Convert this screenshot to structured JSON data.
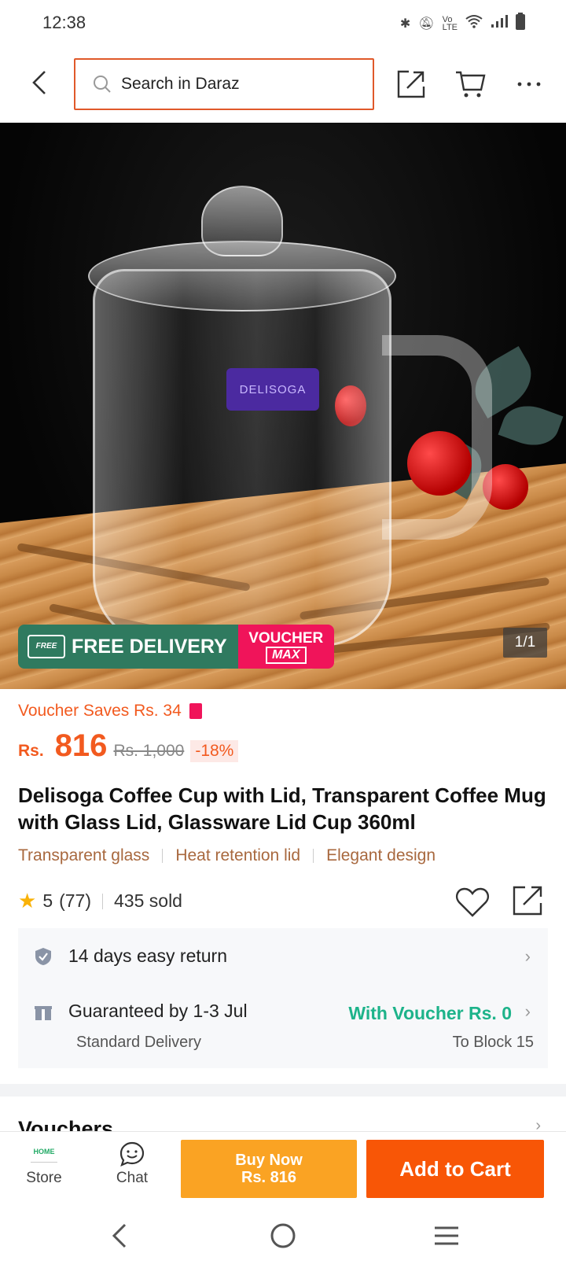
{
  "status_bar": {
    "time": "12:38",
    "icons": [
      "bluetooth-icon",
      "mute-icon",
      "volte-icon",
      "wifi-icon",
      "signal-icon",
      "battery-icon"
    ]
  },
  "header": {
    "search_placeholder": "Search in Daraz"
  },
  "gallery": {
    "brand_print": "DELISOGA",
    "free_delivery": "FREE DELIVERY",
    "truck_label": "FREE",
    "voucher_word": "VOUCHER",
    "max_word": "MAX",
    "counter": "1/1"
  },
  "product": {
    "voucher_saves": "Voucher Saves Rs. 34",
    "currency": "Rs.",
    "price": "816",
    "old_price": "Rs. 1,000",
    "discount": "-18%",
    "title": "Delisoga Coffee Cup with Lid, Transparent Coffee Mug with Glass Lid, Glassware Lid Cup 360ml",
    "tags": [
      "Transparent glass",
      "Heat retention lid",
      "Elegant design"
    ],
    "rating": "5",
    "reviews": "(77)",
    "sold": "435 sold"
  },
  "info": {
    "return_text": "14 days easy return",
    "delivery_text": "Guaranteed by 1-3 Jul",
    "voucher_text": "With Voucher Rs. 0",
    "delivery_type": "Standard Delivery",
    "location": "To Block 15"
  },
  "sections": {
    "vouchers_title": "Vouchers"
  },
  "bottom_bar": {
    "store_label": "Store",
    "store_logo_text": "HOME",
    "chat_label": "Chat",
    "buy_now_line1": "Buy Now",
    "buy_now_line2": "Rs. 816",
    "add_to_cart": "Add to Cart"
  },
  "colors": {
    "accent": "#f85606",
    "buy_now": "#faa323",
    "green": "#1db38a",
    "voucher_pink": "#f0145a"
  }
}
